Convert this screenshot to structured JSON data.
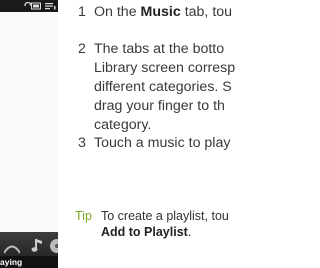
{
  "phone": {
    "status_icons": [
      "sync-icon",
      "battery-icon",
      "signal-icon"
    ],
    "tab_icons": [
      "artist-icon",
      "music-note-icon",
      "album-disc-icon"
    ],
    "now_playing_label": "Playing"
  },
  "steps": [
    {
      "num": "1",
      "prefix": "On the ",
      "bold": "Music",
      "suffix": " tab, tou"
    },
    {
      "num": "2",
      "lines": [
        "The tabs at the botto",
        "Library screen corresp",
        "different categories. S",
        "drag your finger to th",
        "category."
      ]
    },
    {
      "num": "3",
      "text": "Touch a music to play"
    }
  ],
  "tip": {
    "label": "Tip",
    "line1": "To create a playlist, tou",
    "line2_bold": "Add to Playlist",
    "line2_end": "."
  },
  "colors": {
    "tip_accent": "#7aa520",
    "body_text": "#3a3a3a",
    "phone_bar": "#2c2c2c"
  }
}
